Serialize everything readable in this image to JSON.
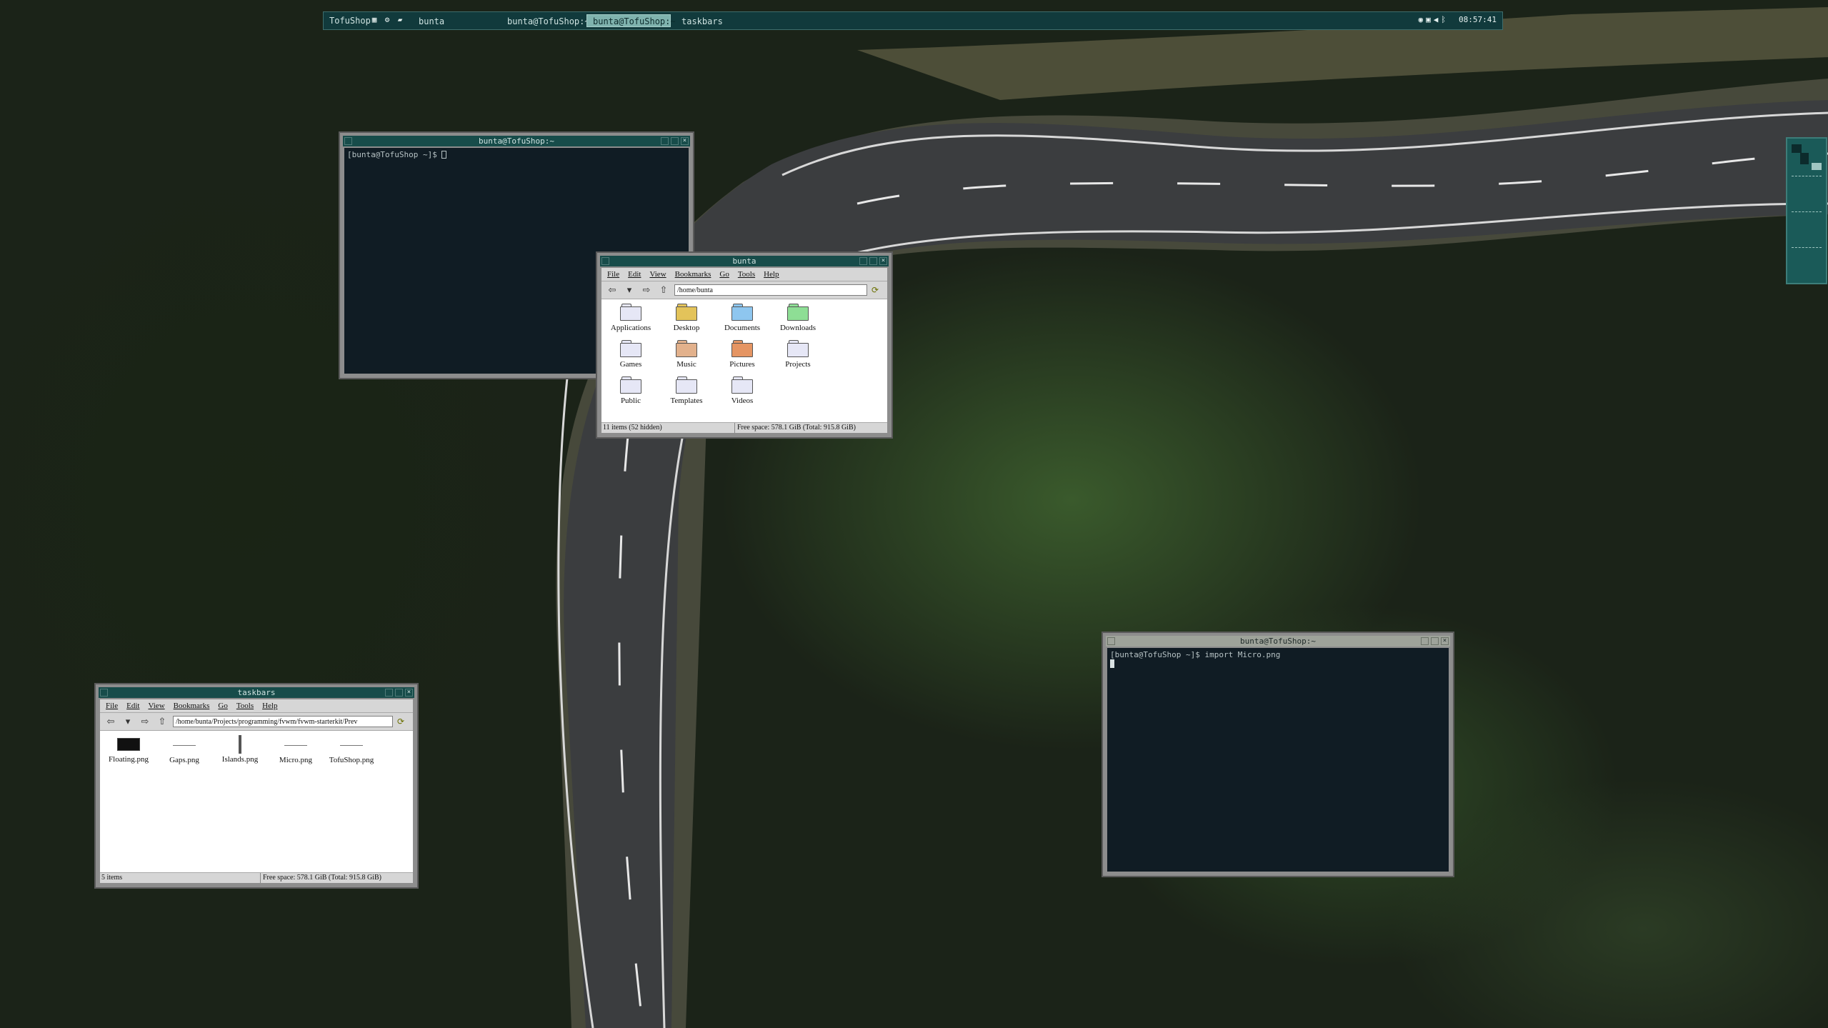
{
  "panel": {
    "hostname": "TofuShop",
    "launchers": [
      "file-manager-icon",
      "settings-icon",
      "folder-icon"
    ],
    "tasks": [
      {
        "label": "bunta",
        "active": false
      },
      {
        "label": "bunta@TofuShop:~",
        "active": false
      },
      {
        "label": "bunta@TofuShop:~",
        "active": true
      },
      {
        "label": "taskbars",
        "active": false
      }
    ],
    "tray": [
      "steam-icon",
      "controller-icon",
      "volume-icon",
      "bluetooth-icon"
    ],
    "clock": "08:57:41"
  },
  "terminal_top": {
    "title": "bunta@TofuShop:~",
    "prompt": "[bunta@TofuShop ~]$ "
  },
  "terminal_bottom": {
    "title": "bunta@TofuShop:~",
    "prompt": "[bunta@TofuShop ~]$ import Micro.png"
  },
  "fm_home": {
    "title": "bunta",
    "menu": [
      "File",
      "Edit",
      "View",
      "Bookmarks",
      "Go",
      "Tools",
      "Help"
    ],
    "location": "/home/bunta",
    "items": [
      {
        "label": "Applications",
        "color": "#e6e7f6"
      },
      {
        "label": "Desktop",
        "color": "#e3c35a"
      },
      {
        "label": "Documents",
        "color": "#8ec6ef"
      },
      {
        "label": "Downloads",
        "color": "#8ede95"
      },
      {
        "label": "Games",
        "color": "#e6e7f6"
      },
      {
        "label": "Music",
        "color": "#e2b18c"
      },
      {
        "label": "Pictures",
        "color": "#e59563"
      },
      {
        "label": "Projects",
        "color": "#e6e7f6"
      },
      {
        "label": "Public",
        "color": "#e6e7f6"
      },
      {
        "label": "Templates",
        "color": "#e6e7f6"
      },
      {
        "label": "Videos",
        "color": "#e6e7f6"
      }
    ],
    "status_left": "11 items (52 hidden)",
    "status_right": "Free space: 578.1 GiB (Total: 915.8 GiB)"
  },
  "fm_taskbars": {
    "title": "taskbars",
    "menu": [
      "File",
      "Edit",
      "View",
      "Bookmarks",
      "Go",
      "Tools",
      "Help"
    ],
    "location": "/home/bunta/Projects/programming/fvwm/fvwm-starterkit/Prev",
    "items": [
      "Floating.png",
      "Gaps.png",
      "Islands.png",
      "Micro.png",
      "TofuShop.png"
    ],
    "status_left": "5 items",
    "status_right": "Free space: 578.1 GiB (Total: 915.8 GiB)"
  }
}
